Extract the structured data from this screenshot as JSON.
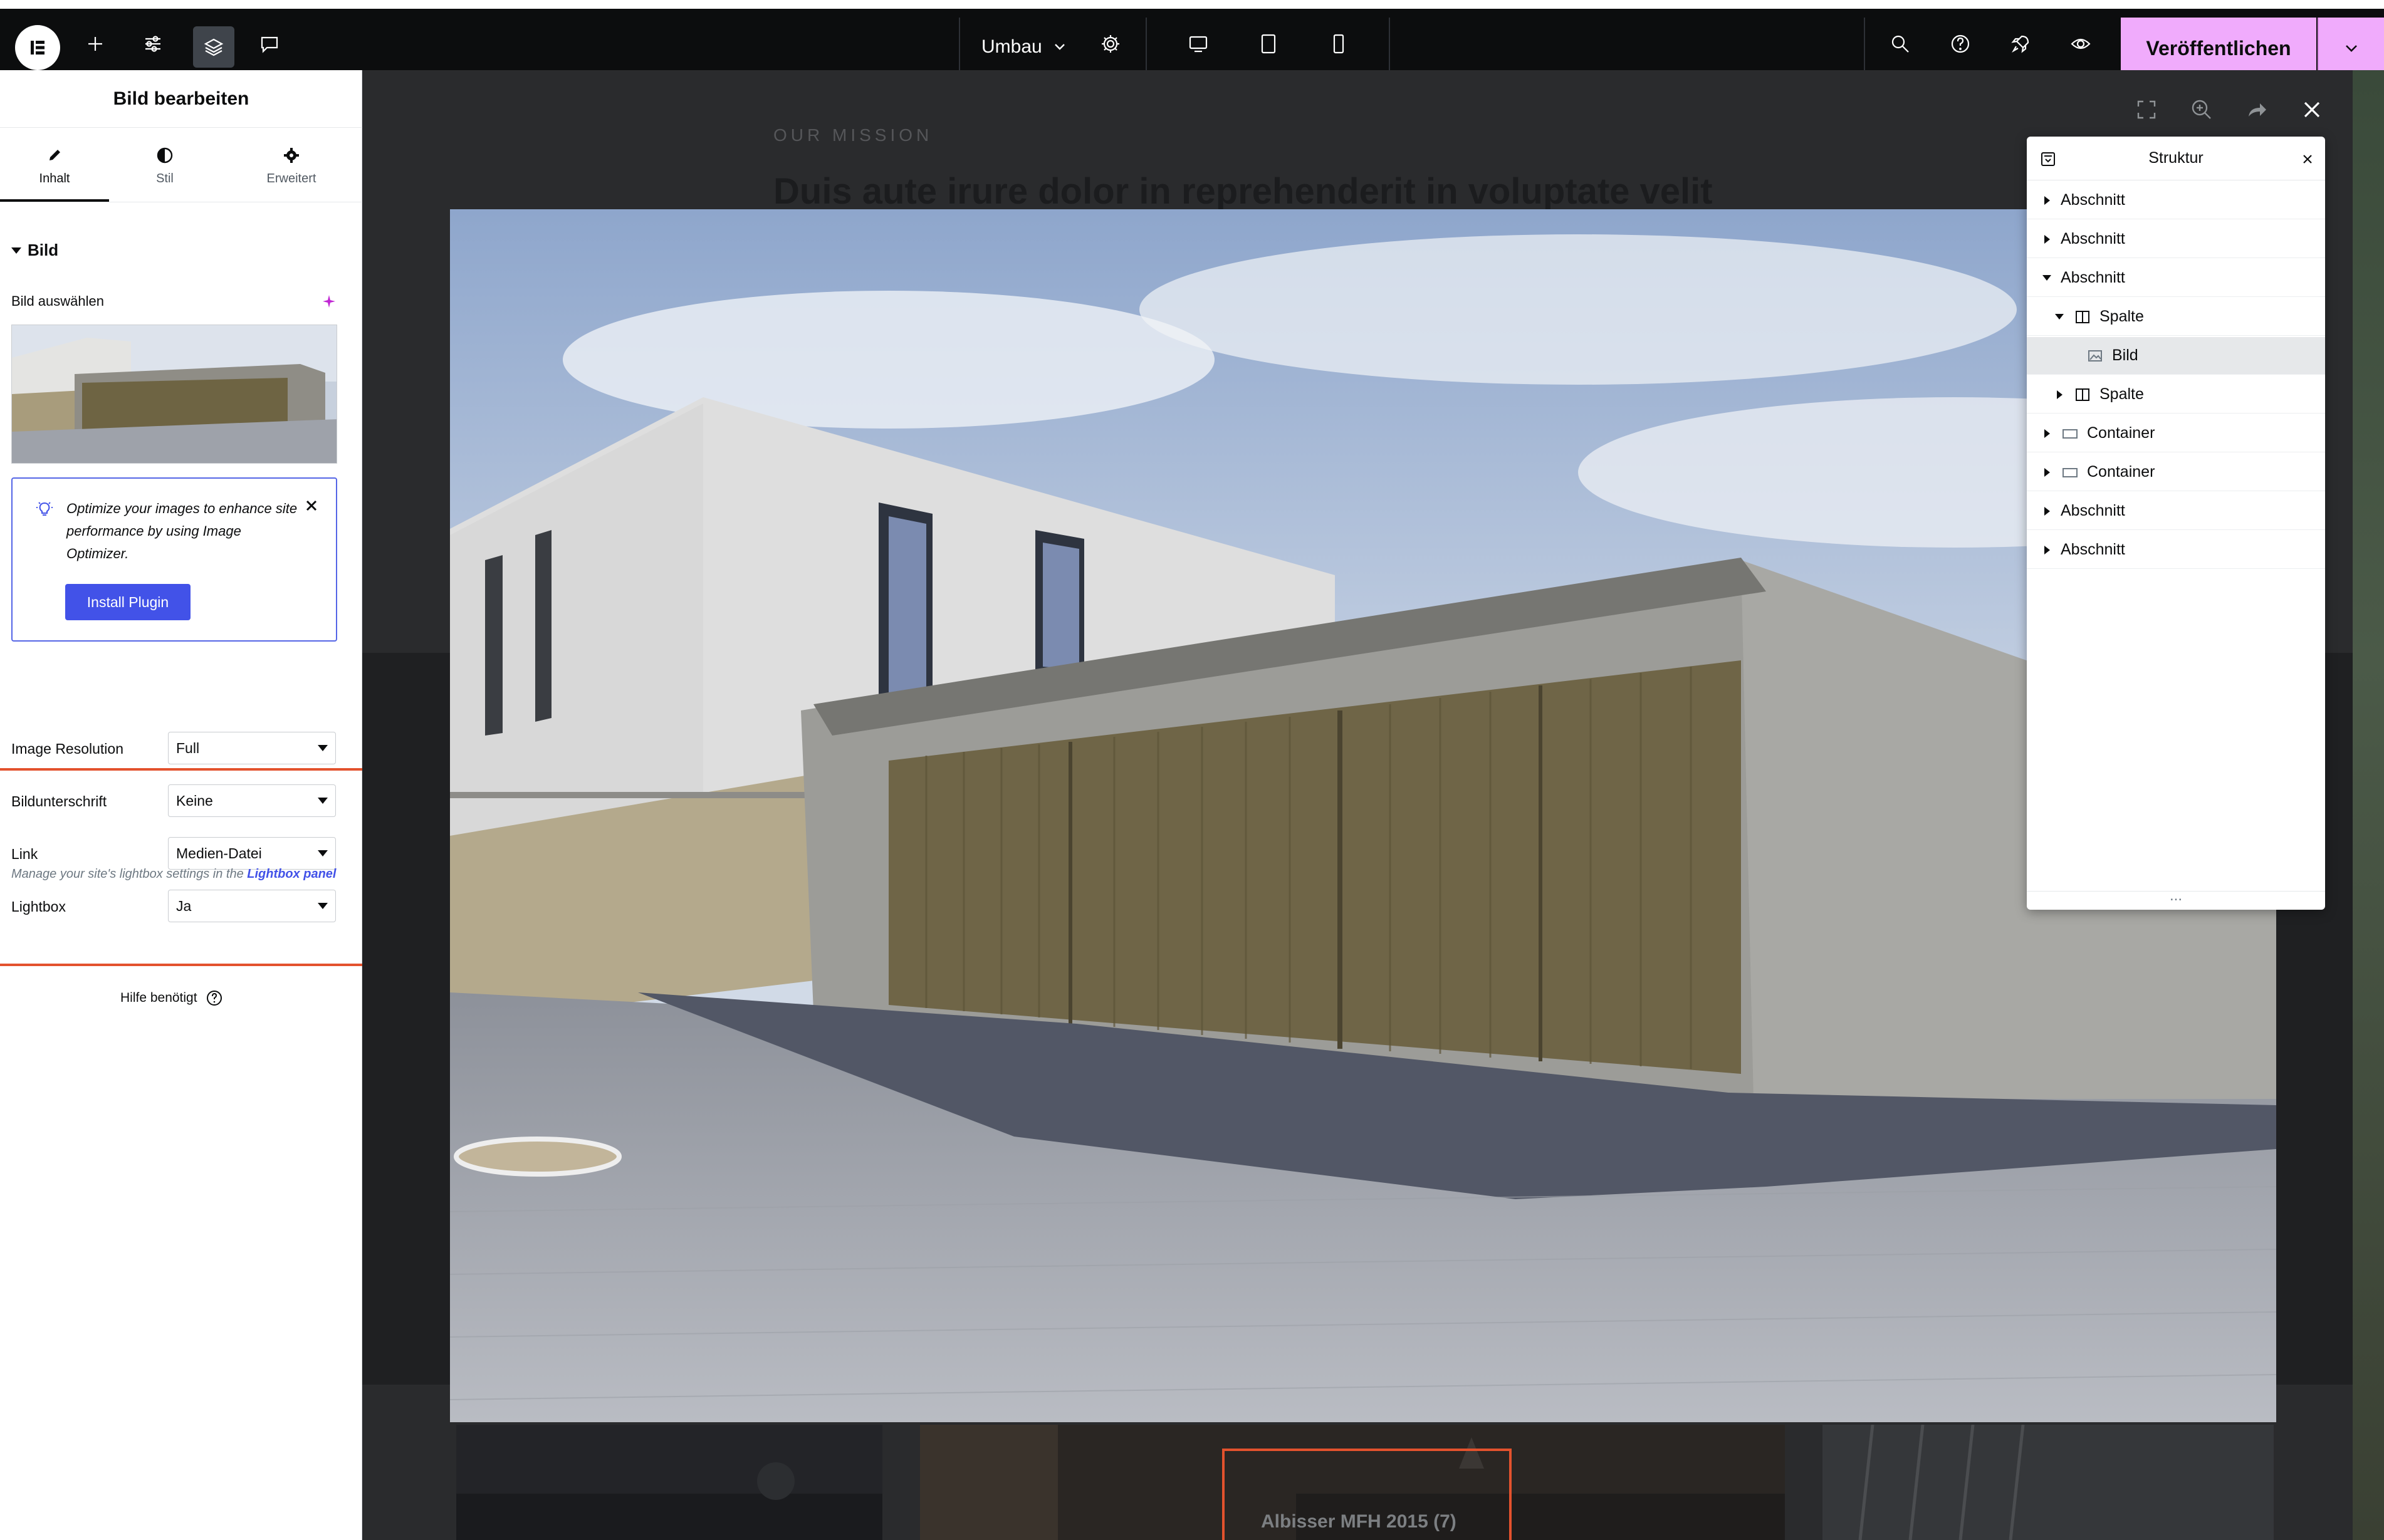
{
  "topbar": {
    "document_title": "Umbau",
    "publish_label": "Veröffentlichen",
    "colors": {
      "background": "#0c0d0e",
      "publish": "#f0abfc"
    }
  },
  "panel": {
    "title": "Bild bearbeiten",
    "tabs": [
      {
        "label": "Inhalt",
        "icon": "pencil-icon",
        "active": true
      },
      {
        "label": "Stil",
        "icon": "contrast-icon",
        "active": false
      },
      {
        "label": "Erweitert",
        "icon": "gear-icon",
        "active": false
      }
    ],
    "section_title": "Bild",
    "choose_image_label": "Bild auswählen",
    "promo": {
      "text": "Optimize your images to enhance site performance by using Image Optimizer.",
      "button": "Install Plugin"
    },
    "controls": [
      {
        "label": "Image Resolution",
        "value": "Full"
      },
      {
        "label": "Bildunterschrift",
        "value": "Keine"
      },
      {
        "label": "Link",
        "value": "Medien-Datei"
      },
      {
        "label": "Lightbox",
        "value": "Ja"
      }
    ],
    "lightbox_note_prefix": "Manage your site's lightbox settings in the ",
    "lightbox_note_link": "Lightbox panel",
    "help_label": "Hilfe benötigt"
  },
  "canvas": {
    "eyebrow": "OUR MISSION",
    "heading": "Duis aute irure dolor in reprehenderit in voluptate velit",
    "gallery_caption": "Albisser MFH 2015 (7)"
  },
  "navigator": {
    "title": "Struktur",
    "items": [
      {
        "label": "Abschnitt",
        "level": 0,
        "caret": "right",
        "icon": ""
      },
      {
        "label": "Abschnitt",
        "level": 0,
        "caret": "right",
        "icon": ""
      },
      {
        "label": "Abschnitt",
        "level": 0,
        "caret": "down",
        "icon": ""
      },
      {
        "label": "Spalte",
        "level": 1,
        "caret": "down",
        "icon": "column-icon"
      },
      {
        "label": "Bild",
        "level": 2,
        "caret": "none",
        "icon": "image-icon",
        "selected": true
      },
      {
        "label": "Spalte",
        "level": 1,
        "caret": "right",
        "icon": "column-icon"
      },
      {
        "label": "Container",
        "level": 0,
        "caret": "right",
        "icon": "container-icon"
      },
      {
        "label": "Container",
        "level": 0,
        "caret": "right",
        "icon": "container-icon"
      },
      {
        "label": "Abschnitt",
        "level": 0,
        "caret": "right",
        "icon": ""
      },
      {
        "label": "Abschnitt",
        "level": 0,
        "caret": "right",
        "icon": ""
      }
    ],
    "footer": "..."
  }
}
